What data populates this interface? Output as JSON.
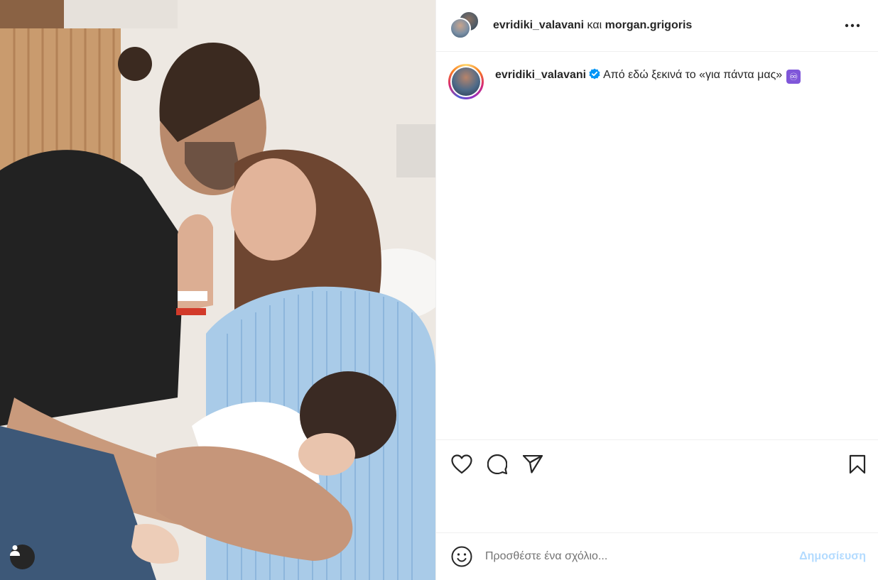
{
  "header": {
    "user1": "evridiki_valavani",
    "conjunction": "και",
    "user2": "morgan.grigoris",
    "more_icon": "more-horizontal-icon"
  },
  "caption": {
    "username": "evridiki_valavani",
    "verified_icon": "verified-badge-icon",
    "text": "Από εδώ ξεκινά το «για πάντα μας»",
    "emoji": "♾"
  },
  "actions": {
    "like_icon": "heart-icon",
    "comment_icon": "comment-icon",
    "share_icon": "share-icon",
    "save_icon": "bookmark-icon"
  },
  "comment": {
    "placeholder": "Προσθέστε ένα σχόλιο...",
    "post_label": "Δημοσίευση",
    "emoji_icon": "smiley-icon"
  },
  "photo": {
    "tag_icon": "user-tag-icon"
  },
  "colors": {
    "verified": "#0095f6",
    "post_disabled": "#b3dbff",
    "border": "#efefef"
  }
}
